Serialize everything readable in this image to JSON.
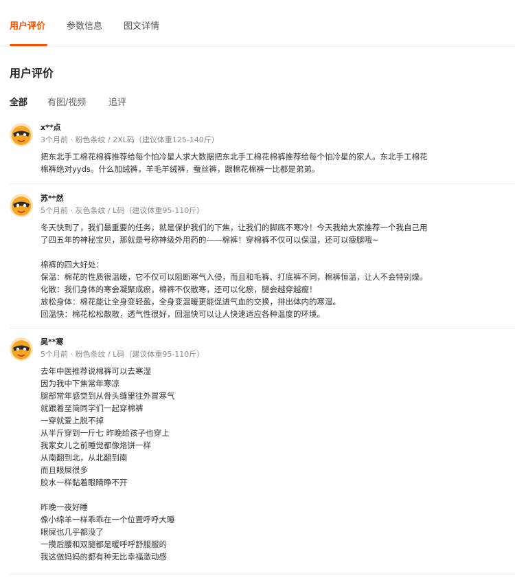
{
  "tabs": [
    {
      "label": "用户评价",
      "active": true
    },
    {
      "label": "参数信息",
      "active": false
    },
    {
      "label": "图文详情",
      "active": false
    }
  ],
  "section_title": "用户评价",
  "filters": [
    {
      "label": "全部",
      "active": true
    },
    {
      "label": "有图/视频",
      "active": false
    },
    {
      "label": "追评",
      "active": false
    }
  ],
  "reviews": [
    {
      "user": "x**点",
      "meta": "3个月前 · 粉色条纹 / 2XL码（建议体重125-140斤）",
      "lines": [
        "把东北手工棉花棉裤推荐给每个怕冷星人求大数据把东北手工棉花棉裤推荐给每个怕冷星的家人。东北手工棉花",
        "棉裤绝对yyds。什么加绒裤，羊毛羊绒裤，蚕丝裤，跟棉花棉裤一比都是弟弟。"
      ]
    },
    {
      "user": "苏**然",
      "meta": "5个月前 · 灰色条纹 / L码（建议体重95-110斤）",
      "lines": [
        "冬天快到了，我们最重要的任务，就是保护我们的下焦，让我们的脚底不寒冷！今天我给大家推荐一个我自己用",
        "了四五年的神秘宝贝，那就是号称神级外用药的——棉裤！穿棉裤不仅可以保温，还可以瘦腿哦~",
        "",
        "棉裤的四大好处：",
        "保温：棉花的性质很温暖，它不仅可以阻断寒气入侵，而且和毛裤、打底裤不同，棉裤恒温，让人不会特别燥。",
        "化散：我们身体的寒会凝聚成瘀，棉裤不仅散寒，还可以化瘀，腿会越穿越瘦！",
        "放松身体：棉花能让全身变轻盈，全身变温暖更能促进气血的交换，排出体内的寒湿。",
        "回温快：棉花松松散散，透气性很好，回温快可以让人快速适应各种温度的环境。"
      ]
    },
    {
      "user": "吴**寒",
      "meta": "5个月前 · 粉色条纹 / L码（建议体重95-110斤）",
      "lines": [
        "去年中医推荐说棉裤可以去寒湿",
        "因为我中下焦常年寒凉",
        "腿部常年感觉到从骨头缝里往外冒寒气",
        "就跟着至简同学们一起穿棉裤",
        "一穿就爱上脱不掉",
        "从半斤穿到一斤七 昨晚给孩子也穿上",
        "我家女儿之前睡觉都像烙饼一样",
        "从南翻到北，从北翻到南",
        "而且眼屎很多",
        "胶水一样黏着眼睛睁不开",
        "",
        "昨晚一夜好睡",
        "像小绵羊一样乖乖在一个位置呼呼大睡",
        "眼屎也几乎都没了",
        "一摸后腰和双腿都是暖呼呼舒服服的",
        "我这做妈妈的都有种无比幸福激动感"
      ]
    }
  ],
  "colors": {
    "accent": "#ff5000",
    "avatar_bg": "#f5a623"
  }
}
